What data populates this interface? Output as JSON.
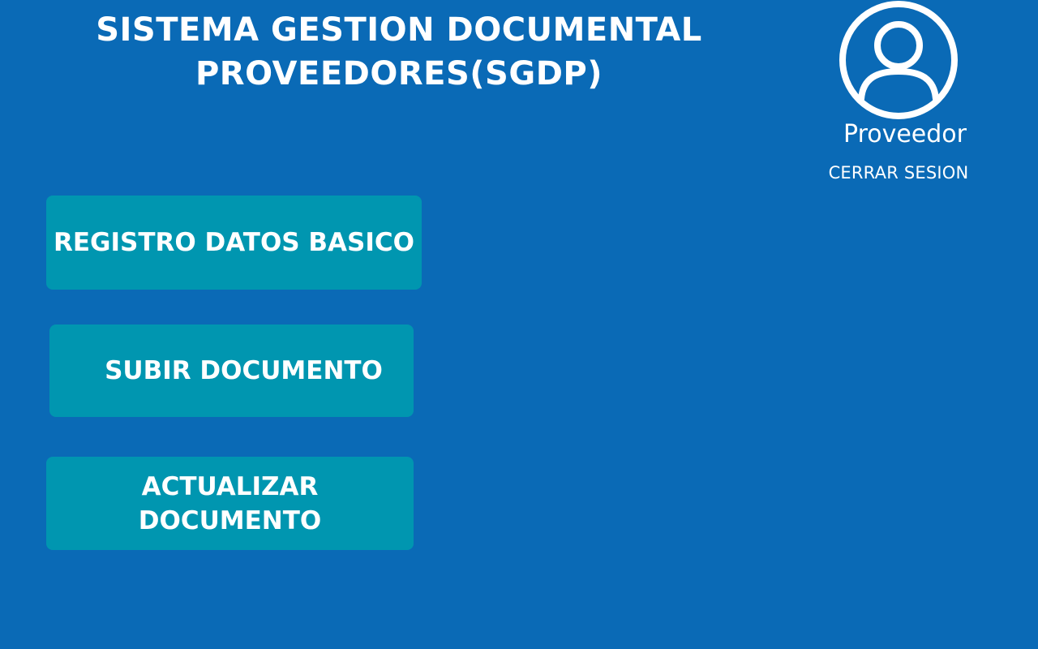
{
  "header": {
    "title_line1": "SISTEMA GESTION DOCUMENTAL",
    "title_line2": "PROVEEDORES(SGDP)"
  },
  "user": {
    "avatar_icon": "user-circle-icon",
    "role": "Proveedor",
    "logout_label": "CERRAR SESION"
  },
  "menu": {
    "items": [
      {
        "label": "REGISTRO DATOS BASICO"
      },
      {
        "label": "SUBIR DOCUMENTO"
      },
      {
        "label": "ACTUALIZAR DOCUMENTO"
      }
    ]
  },
  "colors": {
    "background": "#0a6ab6",
    "button": "#0096b0",
    "text": "#ffffff"
  }
}
